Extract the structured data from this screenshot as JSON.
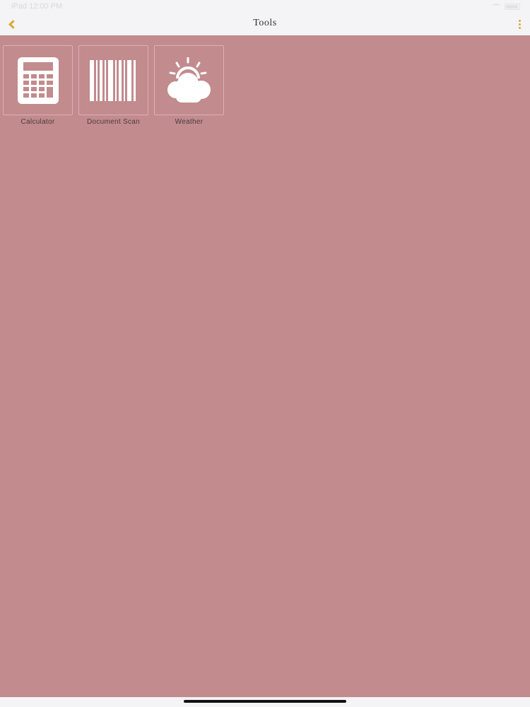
{
  "status_bar": {
    "time": "iPad 12:00 PM"
  },
  "nav": {
    "title": "Tools",
    "back_icon": "chevron-left-icon",
    "menu_icon": "more-vertical-icon"
  },
  "tools": [
    {
      "label": "Calculator",
      "icon": "calculator-icon"
    },
    {
      "label": "Document Scan",
      "icon": "barcode-icon"
    },
    {
      "label": "Weather",
      "icon": "weather-sun-cloud-icon"
    }
  ],
  "colors": {
    "background": "#c28b8d",
    "bar_background": "#f4f3f5",
    "accent": "#d9aa36",
    "tile_border": "#ddb1b3",
    "icon": "#ffffff"
  }
}
